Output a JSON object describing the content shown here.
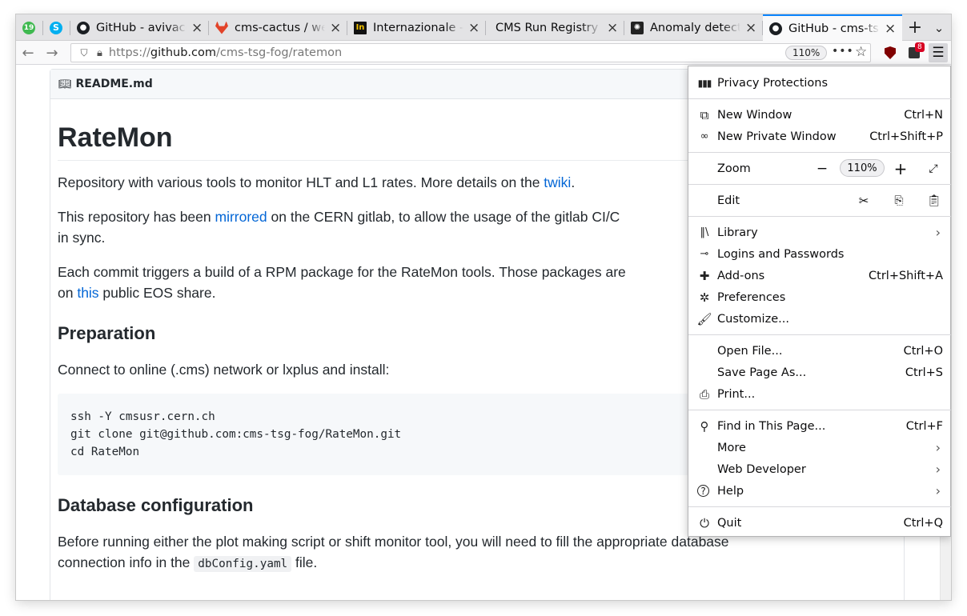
{
  "browser": {
    "tabs": [
      {
        "title": "",
        "favicon": "notification-badge-icon",
        "badge": "19"
      },
      {
        "title": "",
        "favicon": "skype-icon"
      },
      {
        "title": "GitHub - avivace",
        "favicon": "github-icon"
      },
      {
        "title": "cms-cactus / we",
        "favicon": "gitlab-icon"
      },
      {
        "title": "Internazionale -",
        "favicon": "internazionale-icon"
      },
      {
        "title": "CMS Run Registry",
        "favicon": ""
      },
      {
        "title": "Anomaly detecti",
        "favicon": "anomaly-icon"
      },
      {
        "title": "GitHub - cms-ts",
        "favicon": "github-icon",
        "active": true
      }
    ],
    "url_prefix": "https://",
    "url_host": "github.com",
    "url_path": "/cms-tsg-fog/ratemon",
    "zoom": "110%",
    "addon_badge": "8"
  },
  "readme": {
    "filename": "README.md",
    "title": "RateMon",
    "p1_text": "Repository with various tools to monitor HLT and L1 rates. More details on the ",
    "p1_link": "twiki",
    "p1_end": ".",
    "p2_text": "This repository has been ",
    "p2_link": "mirrored",
    "p2_rest": " on the CERN gitlab, to allow the usage of the gitlab CI/C",
    "p2_line2": "in sync.",
    "p3_text": "Each commit triggers a build of a RPM package for the RateMon tools. Those packages are",
    "p3_on": "on ",
    "p3_link": "this",
    "p3_rest": " public EOS share.",
    "h_prep": "Preparation",
    "p4": "Connect to online (.cms) network or lxplus and install:",
    "code_lines": [
      "ssh -Y cmsusr.cern.ch",
      "git clone git@github.com:cms-tsg-fog/RateMon.git",
      "cd RateMon"
    ],
    "h_db": "Database configuration",
    "p5": "Before running either the plot making script or shift monitor tool, you will need to fill the appropriate database",
    "p5_l2a": "connection info in the ",
    "p5_code": "dbConfig.yaml",
    "p5_l2b": " file."
  },
  "menu": {
    "privacy": "Privacy Protections",
    "new_window": "New Window",
    "new_window_sc": "Ctrl+N",
    "private_window": "New Private Window",
    "private_window_sc": "Ctrl+Shift+P",
    "zoom": "Zoom",
    "zoom_minus": "−",
    "zoom_value": "110%",
    "zoom_plus": "+",
    "edit": "Edit",
    "library": "Library",
    "logins": "Logins and Passwords",
    "addons": "Add-ons",
    "addons_sc": "Ctrl+Shift+A",
    "preferences": "Preferences",
    "customize": "Customize...",
    "open_file": "Open File...",
    "open_file_sc": "Ctrl+O",
    "save_page": "Save Page As...",
    "save_page_sc": "Ctrl+S",
    "print": "Print...",
    "find": "Find in This Page...",
    "find_sc": "Ctrl+F",
    "more": "More",
    "web_dev": "Web Developer",
    "help": "Help",
    "quit": "Quit",
    "quit_sc": "Ctrl+Q"
  },
  "colors": {
    "accent": "#0a84ff",
    "link": "#0366d6",
    "text": "#24292e"
  }
}
